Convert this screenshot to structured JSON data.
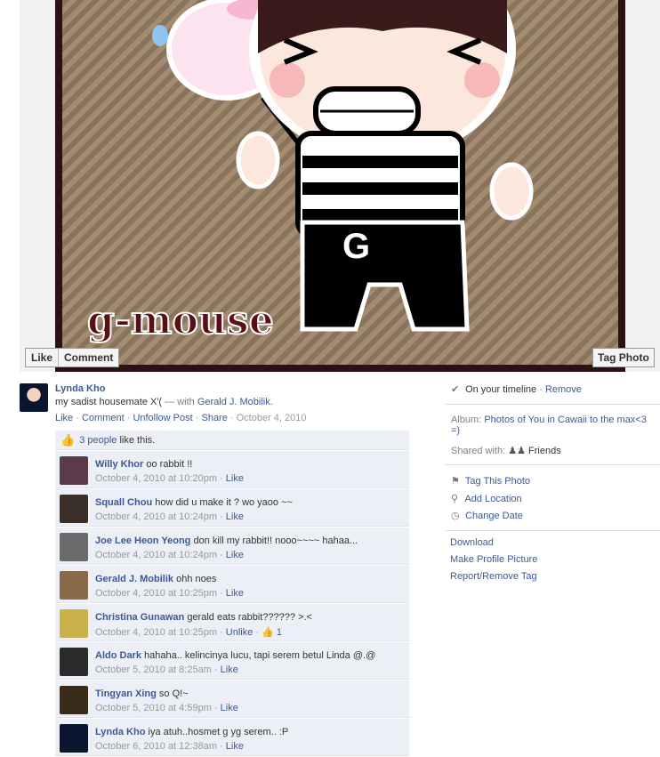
{
  "photo": {
    "watermark": "g-mouse",
    "shirt_letter": "G",
    "buttons": {
      "like": "Like",
      "comment": "Comment",
      "tag_photo": "Tag Photo"
    }
  },
  "post": {
    "author": "Lynda Kho",
    "caption_text": "my sadist housemate X'(",
    "with_text": " — with ",
    "with_name": "Gerald J. Mobilik.",
    "actions": {
      "like": "Like",
      "comment": "Comment",
      "unfollow": "Unfollow Post",
      "share": "Share",
      "date": "October 4, 2010",
      "sep": " · "
    },
    "likes": {
      "count_link": "3 people",
      "suffix": " like this."
    }
  },
  "comments": [
    {
      "name": "Willy Khor",
      "text": "oo rabbit !!",
      "time": "October 4, 2010 at 10:20pm",
      "action": "Like",
      "avatar": "#5b3a4a"
    },
    {
      "name": "Squall Chou",
      "text": "how did u make it ? wo yaoo ~~",
      "time": "October 4, 2010 at 10:24pm",
      "action": "Like",
      "avatar": "#3a3028"
    },
    {
      "name": "Joe Lee Heon Yeong",
      "text": "don kill my rabbit!! nooo~~~~ hahaa...",
      "time": "October 4, 2010 at 10:24pm",
      "action": "Like",
      "avatar": "#6a6a6a"
    },
    {
      "name": "Gerald J. Mobilik",
      "text": "ohh noes",
      "time": "October 4, 2010 at 10:25pm",
      "action": "Like",
      "avatar": "#8a6a4a"
    },
    {
      "name": "Christina Gunawan",
      "text": "gerald eats rabbit?????? >.<",
      "time": "October 4, 2010 at 10:25pm",
      "action": "Unlike",
      "likes": "1",
      "avatar": "#c9b24a"
    },
    {
      "name": "Aldo Dark",
      "text": "hahaha.. kelincinya lucu, tapi serem betul Linda @.@",
      "time": "October 5, 2010 at 8:25am",
      "action": "Like",
      "avatar": "#2a2a2a"
    },
    {
      "name": "Tingyan Xing",
      "text": "so Q!~",
      "time": "October 5, 2010 at 4:59pm",
      "action": "Like",
      "avatar": "#3a2a1a"
    },
    {
      "name": "Lynda Kho",
      "text": "iya atuh..hosmet g yg serem.. :P",
      "time": "October 6, 2010 at 12:38am",
      "action": "Like",
      "avatar": "#0a1630"
    }
  ],
  "sidebar": {
    "timeline_text": "On your timeline",
    "remove": "Remove",
    "album_label": "Album:",
    "album_name": "Photos of You in Cawaii to the max<3 =)",
    "shared_label": "Shared with:",
    "shared_value": "Friends",
    "tag_this_photo": "Tag This Photo",
    "add_location": "Add Location",
    "change_date": "Change Date",
    "download": "Download",
    "make_profile": "Make Profile Picture",
    "report": "Report/Remove Tag"
  }
}
